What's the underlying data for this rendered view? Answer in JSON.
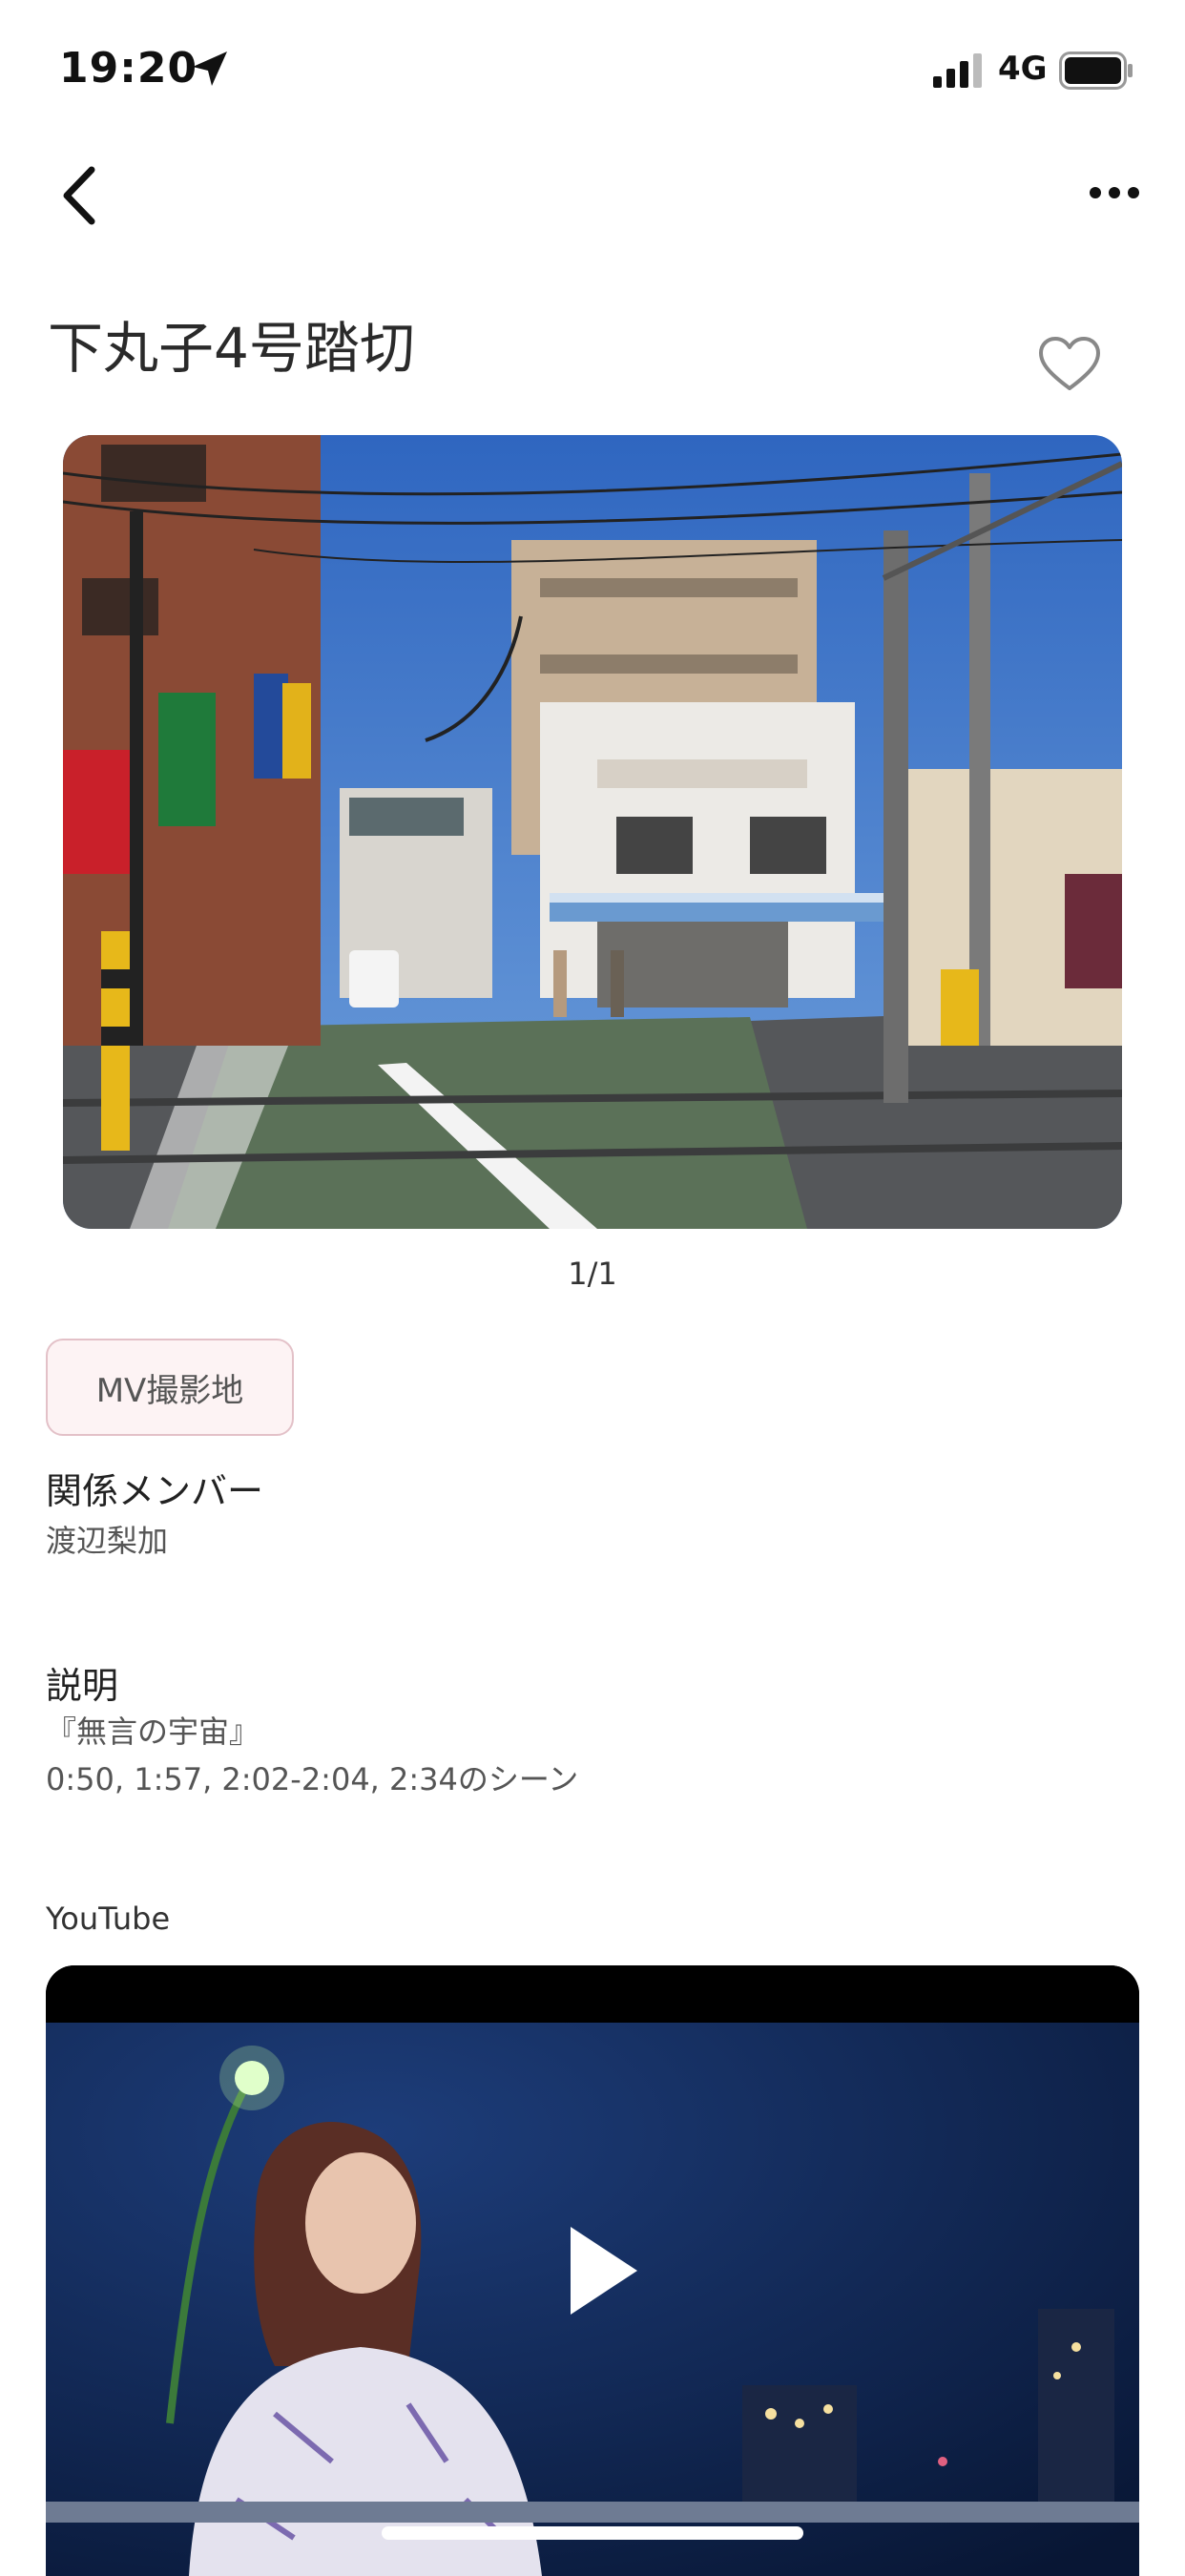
{
  "status": {
    "time": "19:20",
    "network": "4G"
  },
  "nav": {
    "back_icon": "chevron-left-icon",
    "more_icon": "ellipsis-icon"
  },
  "place": {
    "title": "下丸子4号踏切",
    "favorite_icon": "heart-outline-icon"
  },
  "gallery": {
    "pager": "1/1"
  },
  "tag": {
    "label": "MV撮影地"
  },
  "members": {
    "title": "関係メンバー",
    "name": "渡辺梨加"
  },
  "description": {
    "title": "説明",
    "line1": "『無言の宇宙』",
    "line2": "0:50, 1:57, 2:02-2:04, 2:34のシーン"
  },
  "youtube": {
    "label": "YouTube",
    "play_icon": "play-icon"
  },
  "colors": {
    "tag_border": "#e3c1c8",
    "tag_bg": "#fdf3f4",
    "sky": "#3f78c8",
    "video_bg": "#0b1f4a"
  }
}
